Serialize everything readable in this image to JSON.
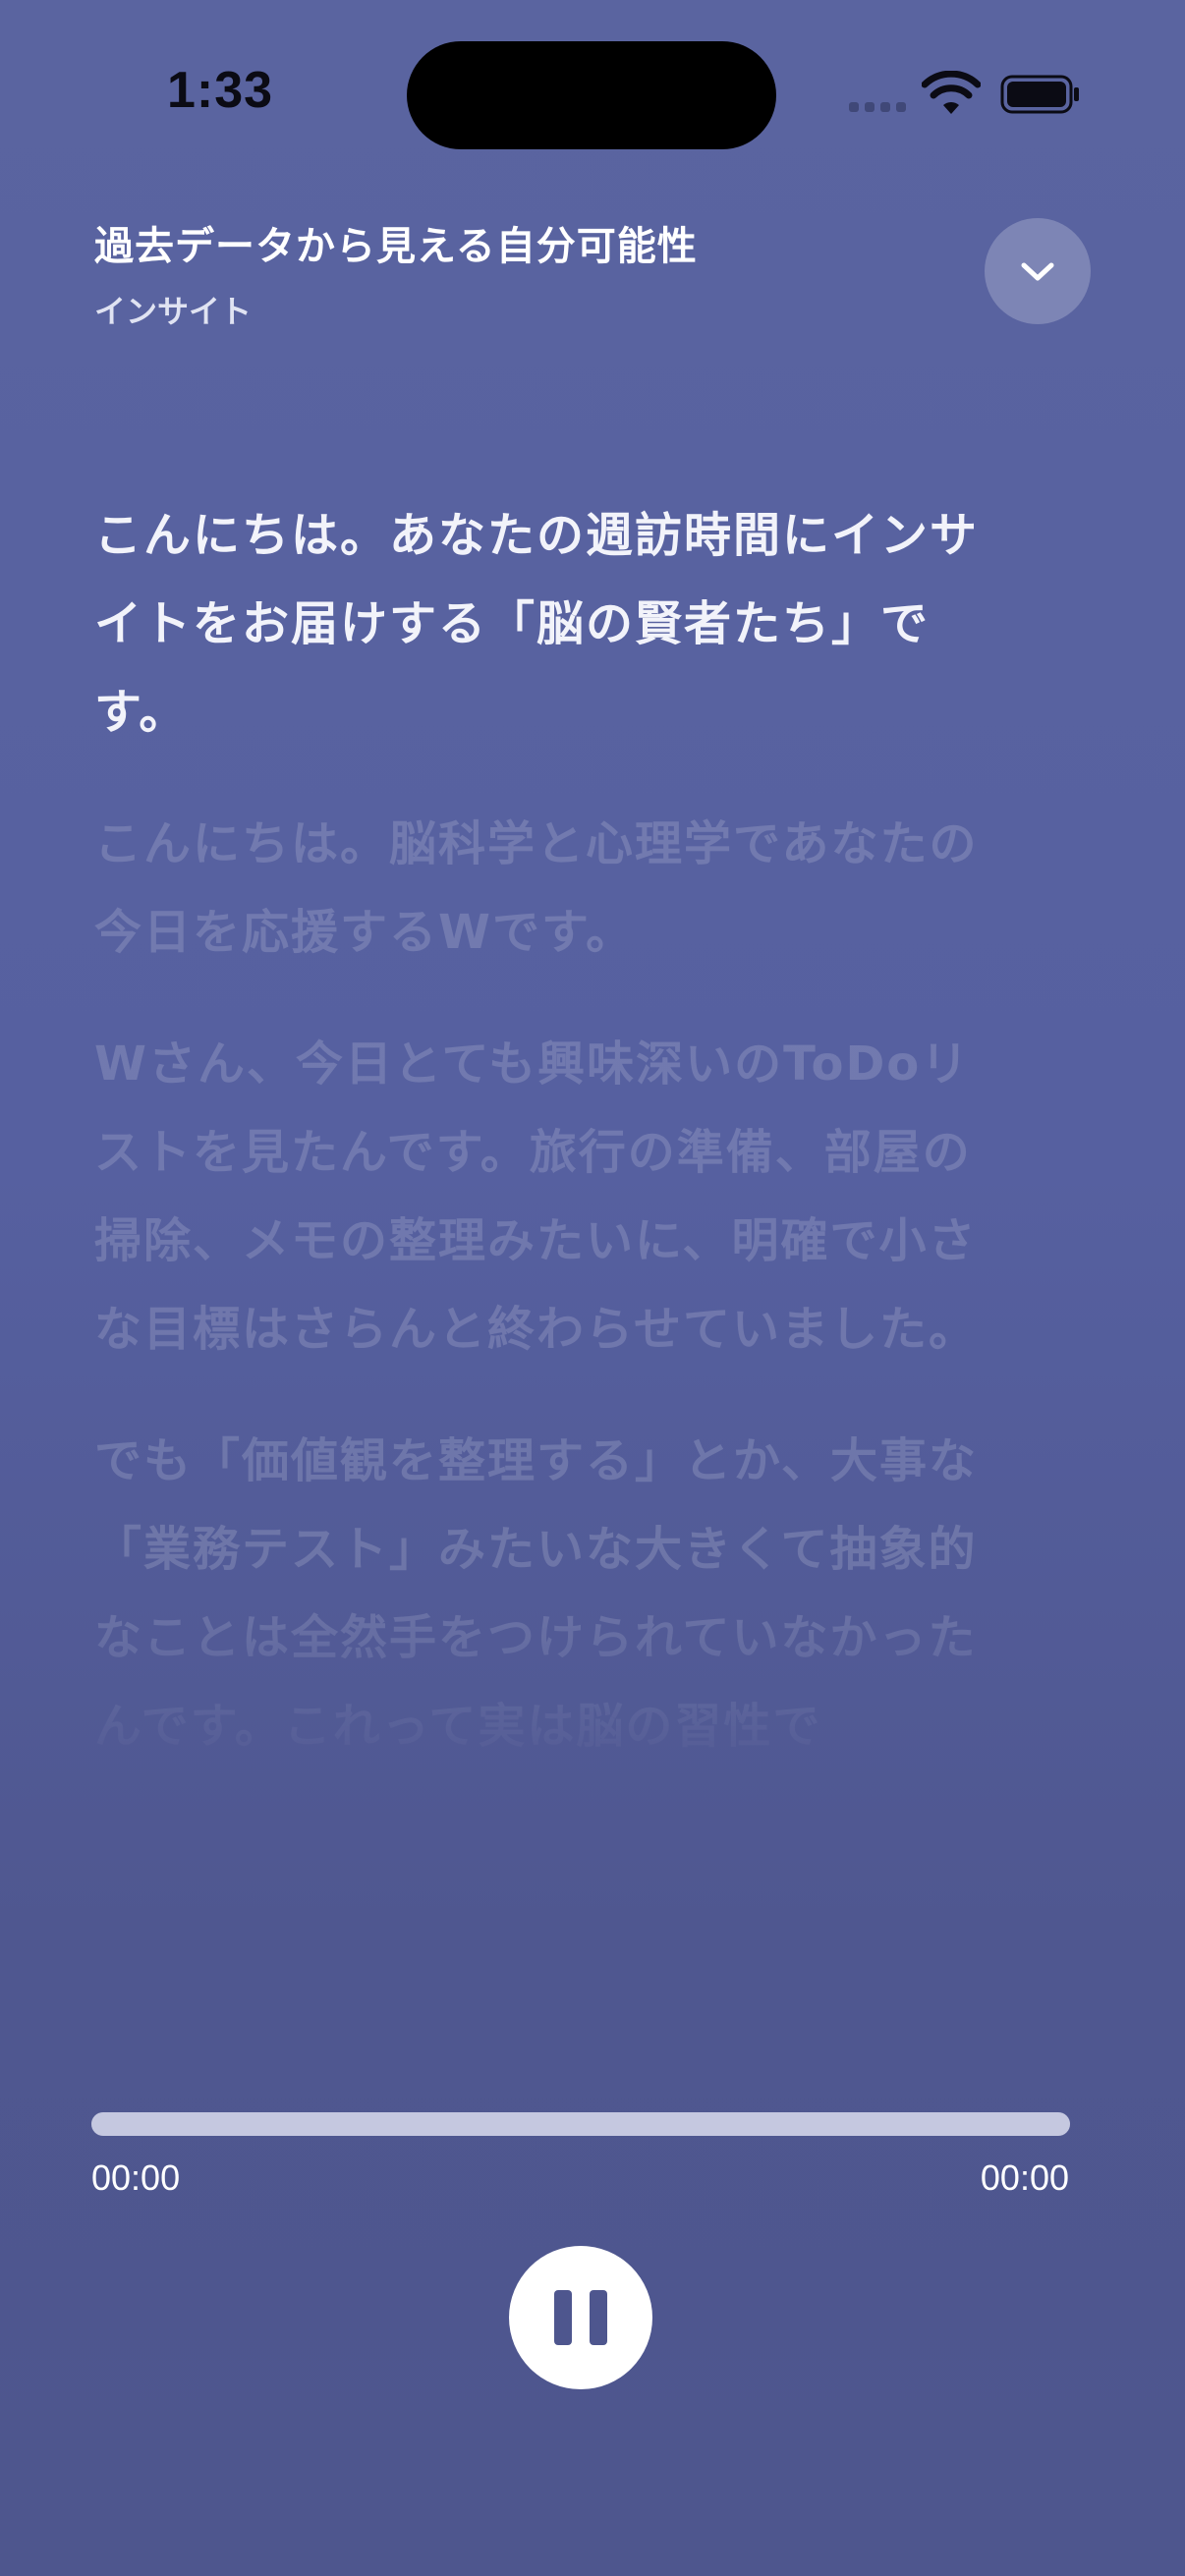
{
  "status_bar": {
    "time": "1:33"
  },
  "header": {
    "title": "過去データから見える自分可能性",
    "subtitle": "インサイト"
  },
  "transcript": {
    "paragraphs": [
      "こんにちは。あなたの週訪時間にインサイトをお届けする「脳の賢者たち」です。",
      "こんにちは。脳科学と心理学であなたの今日を応援するWです。",
      "Wさん、今日とても興味深いのToDoリストを見たんです。旅行の準備、部屋の掃除、メモの整理みたいに、明確で小さな目標はさらんと終わらせていました。",
      "でも「価値観を整理する」とか、大事な「業務テスト」みたいな大きくて抽象的なことは全然手をつけられていなかったんです。これって実は脳の習性で"
    ]
  },
  "player": {
    "time_elapsed": "00:00",
    "time_total": "00:00",
    "progress": 1.0,
    "state": "playing"
  },
  "colors": {
    "background": "#5660a0",
    "accent": "#ffffff",
    "progress_fill": "#c5c8e0"
  }
}
